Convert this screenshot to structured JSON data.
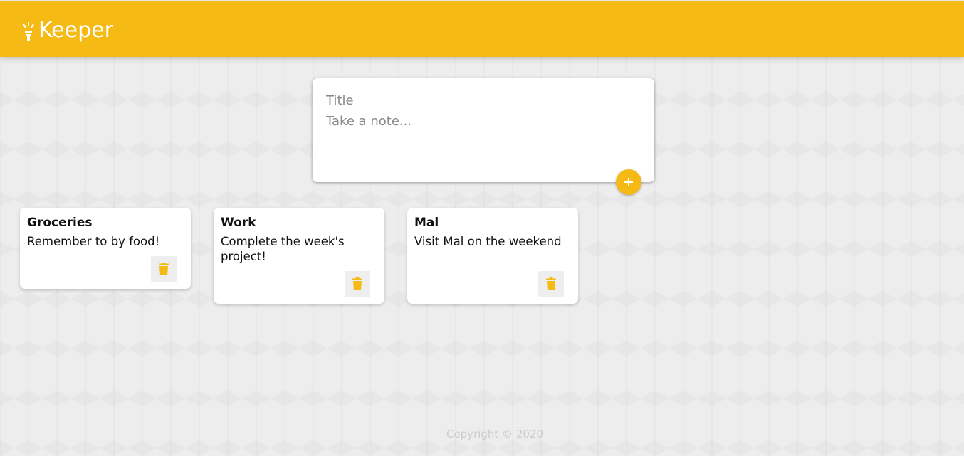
{
  "app": {
    "title": "Keeper",
    "accent_color": "#f5ba13",
    "logo_icon": "lightbulb-icon"
  },
  "create_note": {
    "title_placeholder": "Title",
    "content_placeholder": "Take a note...",
    "add_icon": "plus-icon"
  },
  "notes": [
    {
      "title": "Groceries",
      "content": "Remember to by food!",
      "delete_icon": "trash-icon"
    },
    {
      "title": "Work",
      "content": "Complete the week's project!",
      "delete_icon": "trash-icon"
    },
    {
      "title": "Mal",
      "content": "Visit Mal on the weekend",
      "delete_icon": "trash-icon"
    }
  ],
  "footer": {
    "copyright": "Copyright © 2020"
  }
}
